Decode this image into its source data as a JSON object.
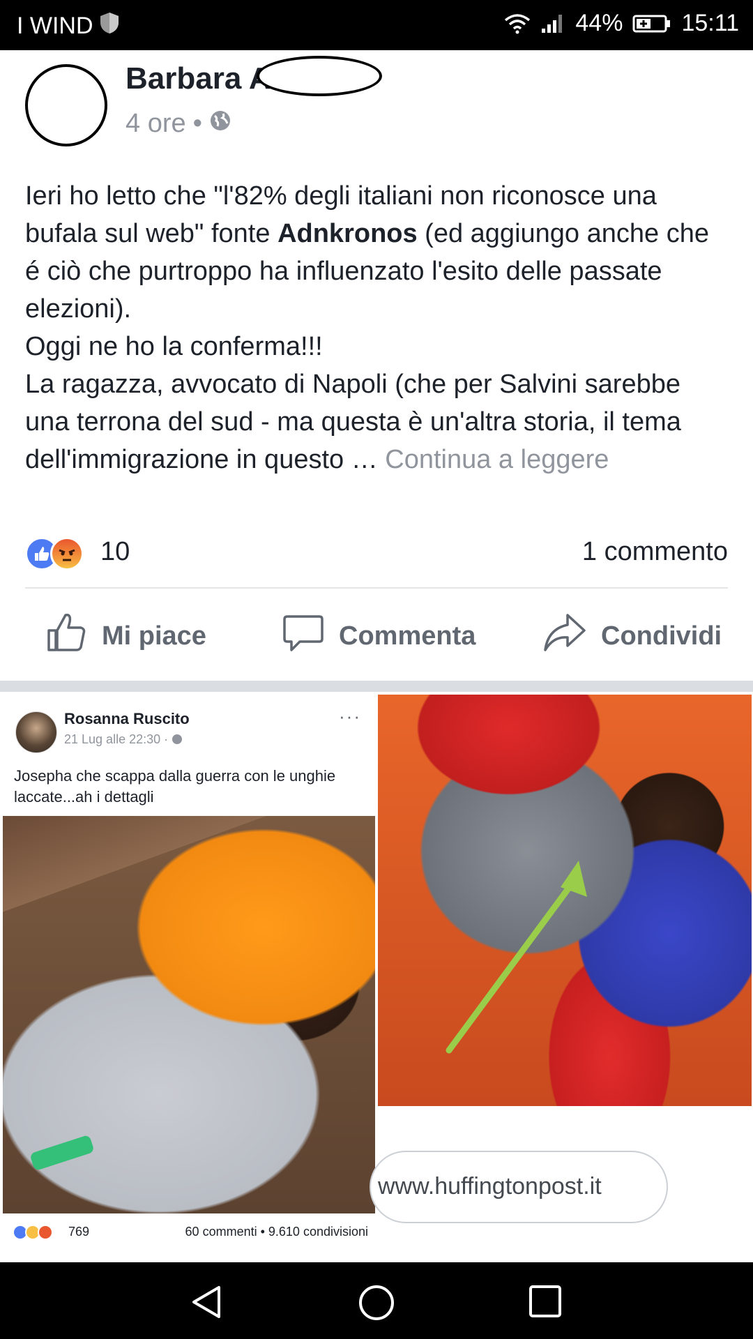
{
  "status_bar": {
    "carrier": "I WIND",
    "battery": "44%",
    "time": "15:11"
  },
  "post": {
    "author": "Barbara A",
    "time": "4 ore",
    "text": {
      "p1_a": "Ieri ho letto che \"l'82% degli italiani non riconosce una bufala sul web\" fonte ",
      "p1_bold": "Adnkronos",
      "p1_b": " (ed aggiungo anche che é ciò che purtroppo ha influenzato l'esito delle passate elezioni).",
      "p2": "Oggi ne ho la conferma!!!",
      "p3": "La ragazza, avvocato di Napoli (che per Salvini sarebbe una terrona del sud - ma questa è un'altra storia, il tema dell'immigrazione in questo … ",
      "continue": "Continua a leggere"
    },
    "reaction_count": "10",
    "comment_count": "1 commento"
  },
  "actions": {
    "like": "Mi piace",
    "comment": "Commenta",
    "share": "Condividi"
  },
  "embedded": {
    "author": "Rosanna Ruscito",
    "meta": "21 Lug alle 22:30 · ",
    "more": "···",
    "text": "Josepha che scappa dalla guerra con le unghie laccate...ah i dettagli",
    "reaction_count": "769",
    "comments": "60 commenti • 9.610 condivisioni",
    "url": "www.huffingtonpost.it"
  },
  "colors": {
    "status_bar_bg": "#000000",
    "like_blue": "#4d7bf3",
    "secondary_text": "#90949c",
    "action_gray": "#606770",
    "arrow_green": "#9acd4a"
  }
}
